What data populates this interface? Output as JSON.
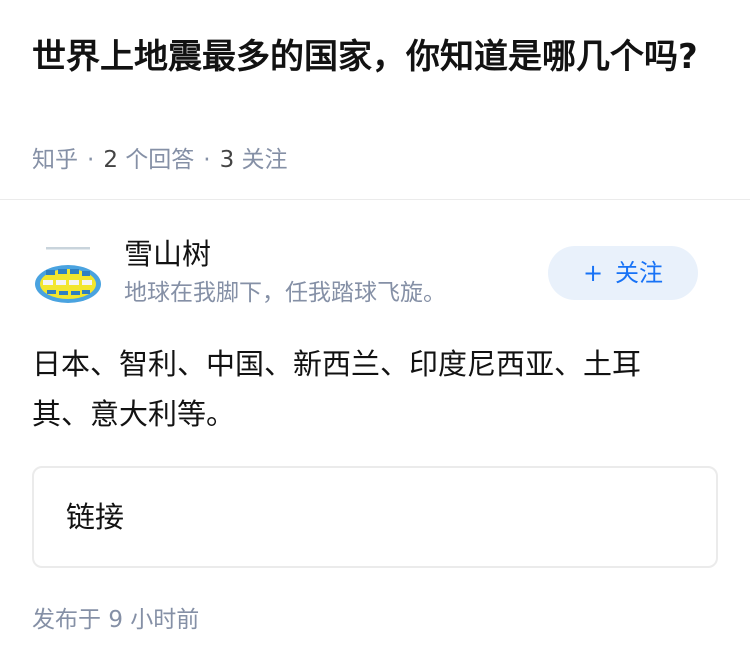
{
  "question": {
    "title": "世界上地震最多的国家，你知道是哪几个吗?",
    "source": "知乎",
    "answer_count": "2",
    "answer_count_unit": "个回答",
    "follow_count": "3",
    "follow_count_unit": "关注",
    "separator": "·"
  },
  "answer": {
    "author": {
      "name": "雪山树",
      "bio": "地球在我脚下，任我踏球飞旋。",
      "avatar_icon": "globe-logo-icon"
    },
    "follow_button": {
      "icon": "+",
      "label": "关注"
    },
    "content": "日本、智利、中国、新西兰、印度尼西亚、土耳其、意大利等。",
    "link_card": {
      "label": "链接"
    },
    "publish_time": {
      "prefix": "发布于",
      "value": "9",
      "unit": "小时前"
    }
  },
  "colors": {
    "title": "#121212",
    "meta": "#8590a6",
    "accent": "#1772f6",
    "follow_button_bg": "#e9f1fb",
    "border": "#ebebeb"
  }
}
